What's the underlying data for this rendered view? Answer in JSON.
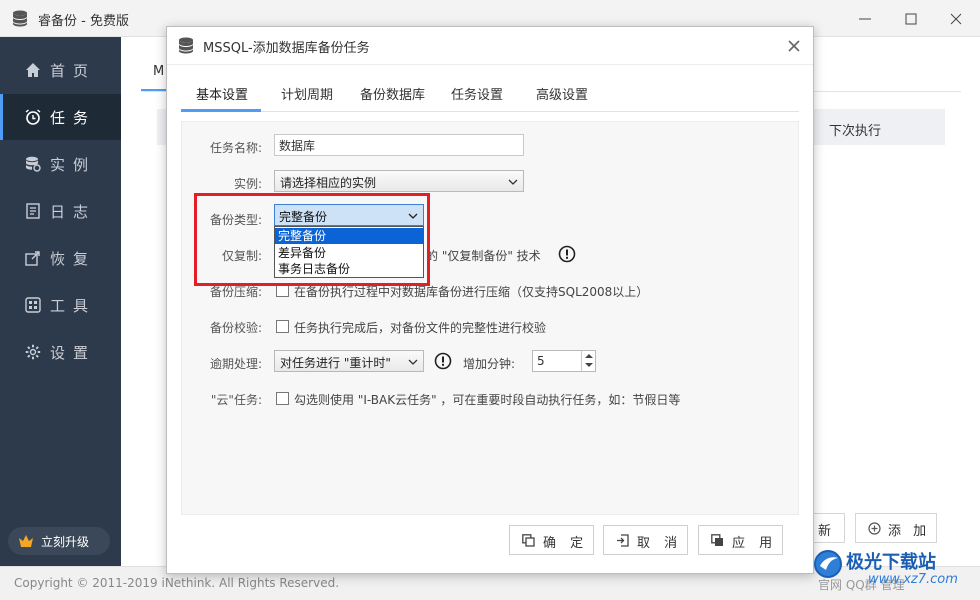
{
  "app": {
    "title": "睿备份 - 免费版"
  },
  "sidebar": {
    "items": [
      {
        "label": "首页",
        "icon": "home-icon"
      },
      {
        "label": "任务",
        "icon": "alarm-clock-icon"
      },
      {
        "label": "实例",
        "icon": "database-instance-icon"
      },
      {
        "label": "日志",
        "icon": "log-icon"
      },
      {
        "label": "恢复",
        "icon": "restore-icon"
      },
      {
        "label": "工具",
        "icon": "tools-icon"
      },
      {
        "label": "设置",
        "icon": "gear-icon"
      }
    ],
    "active_index": 1,
    "upgrade_label": "立刻升级"
  },
  "background": {
    "tab_partial": "M",
    "column_next_run": "下次执行",
    "button_new_partial": "新",
    "button_add": "添 加"
  },
  "footer": {
    "copyright": "Copyright © 2011-2019 iNethink. All Rights Reserved.",
    "links": "官网    QQ群    管理"
  },
  "dialog": {
    "title": "MSSQL-添加数据库备份任务",
    "tabs": [
      "基本设置",
      "计划周期",
      "备份数据库",
      "任务设置",
      "高级设置"
    ],
    "active_tab": 0,
    "fields": {
      "task_name": {
        "label": "任务名称:",
        "value": "数据库"
      },
      "instance": {
        "label": "实例:",
        "value": "请选择相应的实例"
      },
      "backup_type": {
        "label": "备份类型:",
        "value": "完整备份",
        "options": [
          "完整备份",
          "差异备份",
          "事务日志备份"
        ],
        "selected_index": 0
      },
      "copy_only": {
        "label": "仅复制:",
        "text": "的 \"仅复制备份\" 技术"
      },
      "compress": {
        "label": "备份压缩:",
        "text": "在备份执行过程中对数据库备份进行压缩（仅支持SQL2008以上）"
      },
      "verify": {
        "label": "备份校验:",
        "text": "任务执行完成后，对备份文件的完整性进行校验"
      },
      "overdue": {
        "label": "逾期处理:",
        "value": "对任务进行 \"重计时\"",
        "extra_label": "增加分钟:",
        "minutes": "5"
      },
      "cloud": {
        "label": "\"云\"任务:",
        "text": "勾选则使用 \"I-BAK云任务\" ，可在重要时段自动执行任务，如：节假日等"
      }
    },
    "buttons": {
      "ok": "确 定",
      "cancel": "取 消",
      "apply": "应 用"
    }
  },
  "watermark": {
    "brand": "极光下载站",
    "url": "www.xz7.com"
  },
  "colors": {
    "sidebar_bg": "#2d3a4b",
    "accent": "#4f9cf6",
    "highlight_box": "#e21e26",
    "dropdown_selected": "#0a64d6"
  }
}
